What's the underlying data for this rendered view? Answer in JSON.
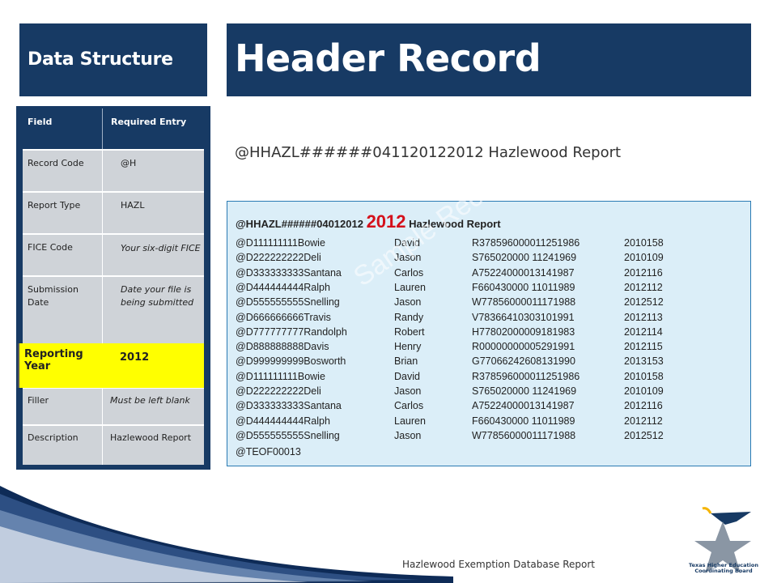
{
  "header": {
    "section_title": "Data Structure",
    "page_title": "Header Record"
  },
  "header_string": "@HHAZL######041120122012 Hazlewood Report",
  "field_table": {
    "columns": [
      "Field",
      "Required Entry"
    ],
    "rows": [
      {
        "field": "Record Code",
        "entry": "@H"
      },
      {
        "field": "Report Type",
        "entry": "HAZL"
      },
      {
        "field": "FICE Code",
        "entry": "Your six-digit FICE"
      },
      {
        "field": "Submission Date",
        "entry": "Date your file is being submitted"
      },
      {
        "field": "Reporting Year",
        "entry": "2012",
        "highlight": true
      },
      {
        "field": "Filler",
        "entry": "Must be left blank"
      },
      {
        "field": "Description",
        "entry": "Hazlewood Report"
      }
    ]
  },
  "sample_report": {
    "header_prefix": "@HHAZL######04012012 ",
    "header_year": "2012",
    "header_suffix": " Hazlewood Report",
    "rows": [
      {
        "code": "@D111111111Bowie",
        "first": "David",
        "id": "R378596000011251986",
        "term": "2010158"
      },
      {
        "code": "@D222222222Deli",
        "first": "Jason",
        "id": "S765020000  11241969",
        "term": "2010109"
      },
      {
        "code": "@D333333333Santana",
        "first": "Carlos",
        "id": " A75224000013141987",
        "term": "2012116"
      },
      {
        "code": "@D444444444Ralph",
        "first": "Lauren",
        "id": "F660430000  11011989",
        "term": "2012112"
      },
      {
        "code": "@D555555555Snelling",
        "first": "Jason",
        "id": "W77856000011171988",
        "term": "2012512"
      },
      {
        "code": "@D666666666Travis",
        "first": "Randy",
        "id": " V78366410303101991",
        "term": "2012113"
      },
      {
        "code": "@D777777777Randolph",
        "first": "Robert",
        "id": " H77802000009181983",
        "term": "2012114"
      },
      {
        "code": "@D888888888Davis",
        "first": "Henry",
        "id": " R00000000005291991",
        "term": "2012115"
      },
      {
        "code": "@D999999999Bosworth",
        "first": "Brian",
        "id": "G77066242608131990",
        "term": "2013153"
      },
      {
        "code": "@D111111111Bowie",
        "first": "David",
        "id": "R378596000011251986",
        "term": "2010158"
      },
      {
        "code": "@D222222222Deli",
        "first": "Jason",
        "id": "S765020000  11241969",
        "term": "2010109"
      },
      {
        "code": "@D333333333Santana",
        "first": "Carlos",
        "id": " A75224000013141987",
        "term": "2012116"
      },
      {
        "code": "@D444444444Ralph",
        "first": "Lauren",
        "id": "F660430000  11011989",
        "term": "2012112"
      },
      {
        "code": "@D555555555Snelling",
        "first": "Jason",
        "id": "W77856000011171988",
        "term": "2012512"
      }
    ],
    "trailer": "@TEOF00013",
    "watermark": "Sample Record"
  },
  "footer": {
    "text": "Hazlewood Exemption Database Report",
    "logo_text": "Texas Higher Education Coordinating Board"
  },
  "colors": {
    "navy": "#173a64",
    "highlight": "#ffff00",
    "report_bg": "#dbeef8",
    "year_red": "#d4101b"
  }
}
